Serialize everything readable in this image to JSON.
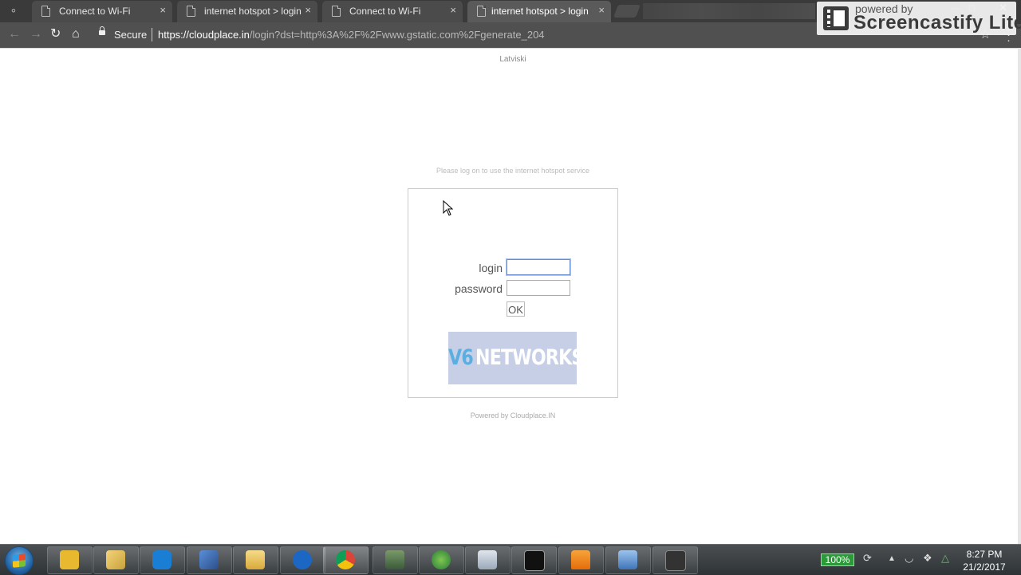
{
  "browser": {
    "tabs": [
      {
        "label": "Connect to Wi-Fi",
        "active": false
      },
      {
        "label": "internet hotspot > login",
        "active": false
      },
      {
        "label": "Connect to Wi-Fi",
        "active": false
      },
      {
        "label": "internet hotspot > login",
        "active": true
      }
    ],
    "tab_close_glyph": "×",
    "secure_label": "Secure",
    "url_host": "https://cloudplace.in",
    "url_path": "/login?dst=http%3A%2F%2Fwww.gstatic.com%2Fgenerate_204"
  },
  "watermark": {
    "powered_by": "powered by",
    "brand": "Screencastify Lite"
  },
  "page": {
    "language_link": "Latviski",
    "notice": "Please log on to use the internet hotspot service",
    "login_label": "login",
    "password_label": "password",
    "login_value": "",
    "password_value": "",
    "ok_label": "OK",
    "logo": {
      "part1": "V6",
      "part2": "NETWORKS"
    },
    "footer": "Powered by Cloudplace.IN"
  },
  "taskbar": {
    "apps": [
      "start-orb",
      "network-tool",
      "file-manager",
      "teamviewer",
      "remote-desktop",
      "windows-explorer",
      "network-app",
      "chrome",
      "utility-app",
      "globe-app",
      "calculator",
      "command-prompt",
      "vlc",
      "control-panel",
      "media-app"
    ],
    "battery": "100%",
    "time": "8:27 PM",
    "date": "21/2/2017"
  },
  "colors": {
    "accent_input": "#6a8fcf",
    "logo_bg": "#c6cfe6",
    "logo_v6": "#5aaee0",
    "battery_green": "#2b9b3a"
  }
}
